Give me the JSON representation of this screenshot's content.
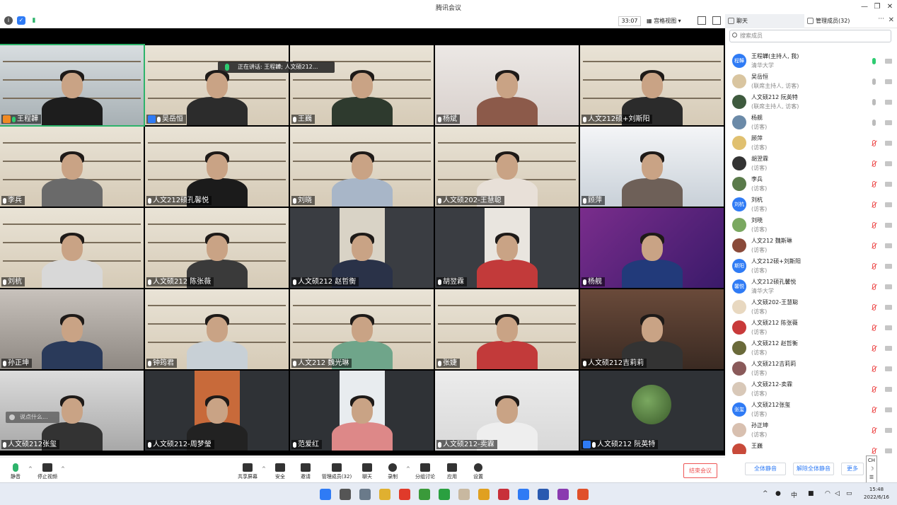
{
  "window": {
    "title": "腾讯会议"
  },
  "toolbar": {
    "timer": "33:07",
    "view_label": "宫格视图"
  },
  "gallery": {
    "speaking_banner": "正在讲话: 王程韡; 人文硕212...",
    "chat_hint": "说点什么...",
    "tiles": [
      {
        "name": "王程韡",
        "host": true,
        "mic": "on",
        "scene": "office",
        "shirt": "#1d1d1d"
      },
      {
        "name": "吴岳恒",
        "cohost": true,
        "scene": "shelf",
        "shirt": "#2c2c2c"
      },
      {
        "name": "王巍",
        "scene": "shelf",
        "shirt": "#2e3a2e"
      },
      {
        "name": "杨斌",
        "scene": "plain",
        "shirt": "#8c5a4a"
      },
      {
        "name": "人文212硕+刘斯阳",
        "scene": "shelf",
        "shirt": "#2b2b2b"
      },
      {
        "name": "李兵",
        "scene": "shelf",
        "shirt": "#6a6a6a"
      },
      {
        "name": "人文212硕孔馨悦",
        "scene": "shelf",
        "shirt": "#1b1b1b"
      },
      {
        "name": "刘晓",
        "scene": "shelf",
        "shirt": "#a8b6c8"
      },
      {
        "name": "人文硕202-王慧聪",
        "scene": "shelf",
        "shirt": "#e8e0d8"
      },
      {
        "name": "顾萍",
        "scene": "room",
        "shirt": "#6e6058"
      },
      {
        "name": "刘杭",
        "scene": "shelf",
        "shirt": "#d8d8d8"
      },
      {
        "name": "人文硕212 陈张薇",
        "scene": "shelf",
        "shirt": "#3a3a3a"
      },
      {
        "name": "人文硕212 赵哲衡",
        "scene": "dark",
        "shirt": "#2a3248"
      },
      {
        "name": "胡翌霖",
        "scene": "dark",
        "shirt": "#c23a3a"
      },
      {
        "name": "杨舰",
        "scene": "slide",
        "shirt": "#223a7a"
      },
      {
        "name": "孙正坤",
        "scene": "blur",
        "shirt": "#2a3a5a"
      },
      {
        "name": "钟筠君",
        "scene": "shelf",
        "shirt": "#c8d0d6"
      },
      {
        "name": "人文212 魏光琳",
        "scene": "shelf",
        "shirt": "#6fa58a"
      },
      {
        "name": "张婕",
        "scene": "shelf",
        "shirt": "#c23a3a"
      },
      {
        "name": "人文硕212吉莉莉",
        "scene": "books",
        "shirt": "#333"
      },
      {
        "name": "人文硕212张玺",
        "scene": "loft",
        "shirt": "#333"
      },
      {
        "name": "人文硕212-周梦瑩",
        "scene": "darkbox",
        "shirt": "#222"
      },
      {
        "name": "范爱红",
        "scene": "darkbox2",
        "shirt": "#d88"
      },
      {
        "name": "人文硕212-卖霖",
        "scene": "plain2",
        "shirt": "#eee"
      },
      {
        "name": "人文硕212 阮英特",
        "cohost": true,
        "scene": "avatar",
        "shirt": "#000"
      }
    ]
  },
  "panel": {
    "tab_chat": "聊天",
    "tab_members": "管理成员(32)",
    "search_placeholder": "搜索成员",
    "members": [
      {
        "name": "王程韡(主持人, 我)",
        "role": "清华大学",
        "avatar": "程韡",
        "color": "#2f7bf5",
        "mic": "on"
      },
      {
        "name": "吴岳恒",
        "role": "(联席主持人, 访客)",
        "avatar": "",
        "color": "#d9c5a0",
        "mic": "idle"
      },
      {
        "name": "人文硕212 阮英特",
        "role": "(联席主持人, 访客)",
        "avatar": "",
        "color": "#3e5a3e",
        "mic": "idle"
      },
      {
        "name": "杨舰",
        "role": "(访客)",
        "avatar": "",
        "color": "#6b8aa8",
        "mic": "idle"
      },
      {
        "name": "顾萍",
        "role": "(访客)",
        "avatar": "",
        "color": "#e0c070",
        "mic": "off"
      },
      {
        "name": "胡翌霖",
        "role": "(访客)",
        "avatar": "",
        "color": "#333",
        "mic": "off"
      },
      {
        "name": "李兵",
        "role": "(访客)",
        "avatar": "",
        "color": "#5a7a4a",
        "mic": "off"
      },
      {
        "name": "刘杭",
        "role": "(访客)",
        "avatar": "刘杭",
        "color": "#2f7bf5",
        "mic": "off"
      },
      {
        "name": "刘晓",
        "role": "(访客)",
        "avatar": "",
        "color": "#7aa860",
        "mic": "off"
      },
      {
        "name": "人文212 魏斯琳",
        "role": "(访客)",
        "avatar": "",
        "color": "#8a4a3a",
        "mic": "off"
      },
      {
        "name": "人文212硕+刘斯阳",
        "role": "(访客)",
        "avatar": "斯阳",
        "color": "#2f7bf5",
        "mic": "off"
      },
      {
        "name": "人文212硕孔馨悦",
        "role": "清华大学",
        "avatar": "馨悦",
        "color": "#2f7bf5",
        "mic": "off"
      },
      {
        "name": "人文硕202-王慧聪",
        "role": "(访客)",
        "avatar": "",
        "color": "#e8d8c0",
        "mic": "off"
      },
      {
        "name": "人文硕212 陈张薇",
        "role": "(访客)",
        "avatar": "",
        "color": "#c83a3a",
        "mic": "off"
      },
      {
        "name": "人文硕212 赵哲衡",
        "role": "(访客)",
        "avatar": "",
        "color": "#6a6a3a",
        "mic": "off"
      },
      {
        "name": "人文硕212吉莉莉",
        "role": "(访客)",
        "avatar": "",
        "color": "#8a5a5a",
        "mic": "off"
      },
      {
        "name": "人文硕212-卖霖",
        "role": "(访客)",
        "avatar": "",
        "color": "#d8c8b8",
        "mic": "off"
      },
      {
        "name": "人文硕212张玺",
        "role": "(访客)",
        "avatar": "张玺",
        "color": "#2f7bf5",
        "mic": "off"
      },
      {
        "name": "孙正坤",
        "role": "(访客)",
        "avatar": "",
        "color": "#d8c0b0",
        "mic": "off"
      },
      {
        "name": "王巍",
        "role": "",
        "avatar": "",
        "color": "#c84a3a",
        "mic": "off"
      }
    ],
    "mute_all": "全体静音",
    "unmute_all": "解除全体静音",
    "more": "更多"
  },
  "controls": {
    "mute": "静音",
    "stop_video": "停止视频",
    "share": "共享屏幕",
    "security": "安全",
    "invite": "邀请",
    "members": "管理成员(32)",
    "chat": "聊天",
    "record": "录制",
    "breakout": "分组讨论",
    "apps": "应用",
    "settings": "设置",
    "end": "结束会议"
  },
  "ime": {
    "lang": "CH"
  },
  "taskbar": {
    "time": "15:48",
    "date": "2022/6/16",
    "ime_tray": "中"
  }
}
